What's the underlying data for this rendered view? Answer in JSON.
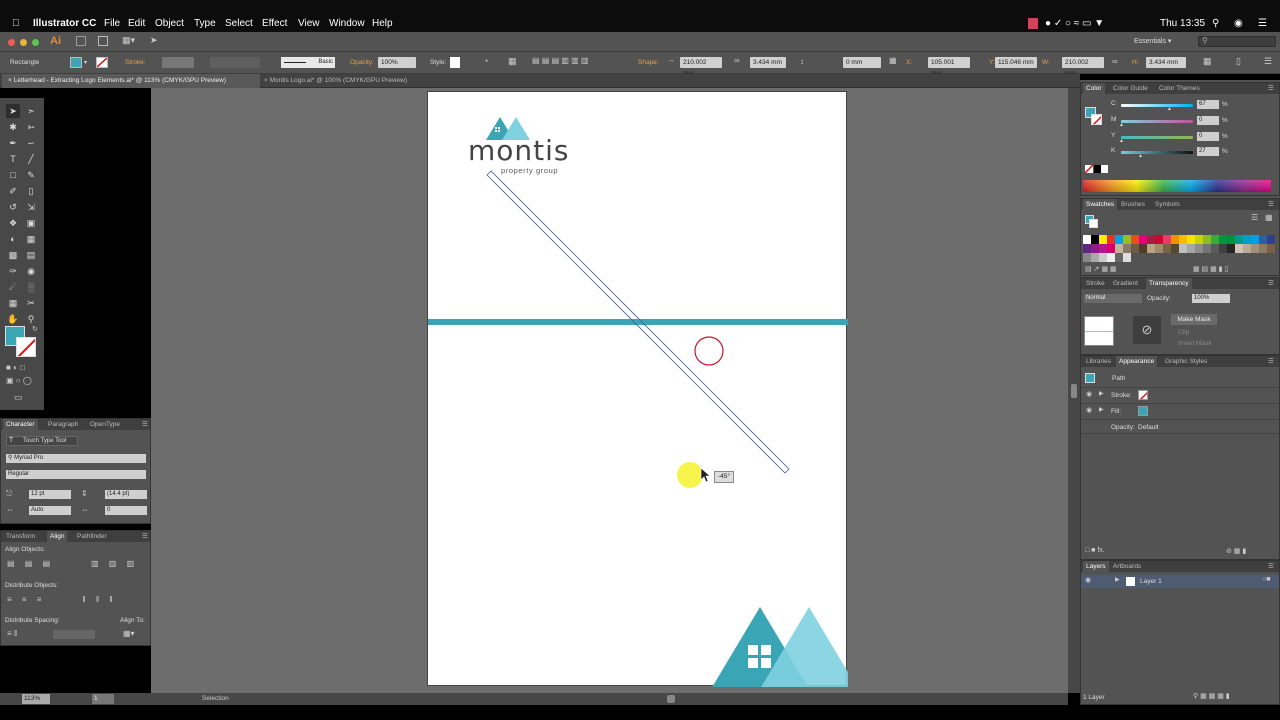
{
  "menubar": {
    "apple": "",
    "app_name": "Illustrator CC",
    "items": [
      "File",
      "Edit",
      "Object",
      "Type",
      "Select",
      "Effect",
      "View",
      "Window",
      "Help"
    ],
    "clock": "Thu 13:35"
  },
  "appbar": {
    "logo": "Ai",
    "workspace": "Essentials",
    "search_placeholder": ""
  },
  "control": {
    "selection_type": "Rectangle",
    "stroke_label": "Stroke:",
    "brush": "Basic",
    "opacity_label": "Opacity:",
    "opacity_value": "100%",
    "style_label": "Style:",
    "shape_label": "Shape:",
    "shape_w": "210.002 mm",
    "shape_h": "3.434 mm",
    "corner": "0 mm",
    "x_label": "X:",
    "x_value": "105.001 mm",
    "y_label": "Y:",
    "y_value": "115.046 mm",
    "w_label": "W:",
    "w_value": "210.002 mm",
    "h_label": "H:",
    "h_value": "3.434 mm"
  },
  "doc_tabs": [
    "Letterhead - Extracting Logo Elements.ai* @ 113% (CMYK/GPU Preview)",
    "Montis Logo.ai* @ 100% (CMYK/GPU Preview)"
  ],
  "artboard": {
    "logo_word": "montis",
    "logo_sub": "property group",
    "angle_tooltip": "-45°",
    "accent_color": "#3aa6b5",
    "light_accent": "#7fd1e0"
  },
  "status": {
    "zoom": "113%",
    "page": "1",
    "tool": "Selection"
  },
  "character_panel": {
    "tabs": [
      "Character",
      "Paragraph",
      "OpenType"
    ],
    "touch_type": "Touch Type Tool",
    "font": "Myriad Pro",
    "style": "Regular",
    "size": "12 pt",
    "leading": "(14.4 pt)",
    "kerning": "Auto",
    "tracking": "0"
  },
  "align_panel": {
    "tabs": [
      "Transform",
      "Align",
      "Pathfinder"
    ],
    "align_objects": "Align Objects:",
    "distribute_objects": "Distribute Objects:",
    "distribute_spacing": "Distribute Spacing:",
    "align_to": "Align To:"
  },
  "color_panel": {
    "tabs": [
      "Color",
      "Color Guide",
      "Color Themes"
    ],
    "channels": [
      {
        "name": "C",
        "value": "67",
        "fill": 0.67
      },
      {
        "name": "M",
        "value": "0",
        "fill": 0.0
      },
      {
        "name": "Y",
        "value": "0",
        "fill": 0.0
      },
      {
        "name": "K",
        "value": "27",
        "fill": 0.27
      }
    ],
    "percent": "%"
  },
  "swatches_panel": {
    "tabs": [
      "Swatches",
      "Brushes",
      "Symbols"
    ]
  },
  "transparency_panel": {
    "tabs": [
      "Stroke",
      "Gradient",
      "Transparency"
    ],
    "blend_mode": "Normal",
    "opacity_label": "Opacity:",
    "opacity_value": "100%",
    "make_mask": "Make Mask",
    "clip": "Clip",
    "invert_mask": "Invert Mask"
  },
  "appearance_panel": {
    "tabs": [
      "Libraries",
      "Appearance",
      "Graphic Styles"
    ],
    "object": "Path",
    "stroke": "Stroke:",
    "fill": "Fill:",
    "opacity": "Opacity:",
    "opacity_value": "Default"
  },
  "layers_panel": {
    "tabs": [
      "Layers",
      "Artboards"
    ],
    "layer_name": "Layer 1",
    "count": "1 Layer"
  }
}
